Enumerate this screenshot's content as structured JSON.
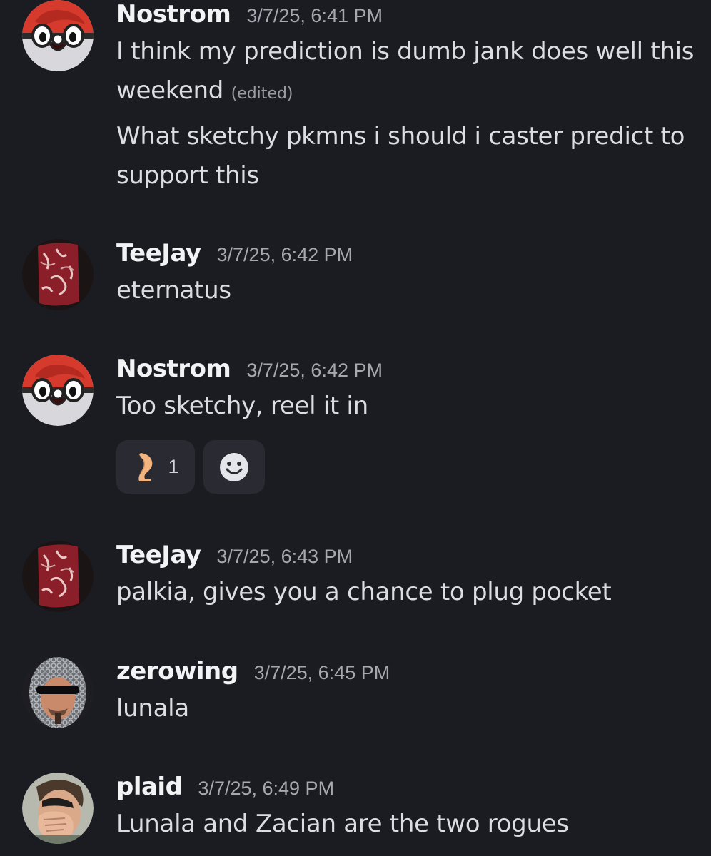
{
  "messages": [
    {
      "author": "Nostrom",
      "timestamp": "3/7/25, 6:41 PM",
      "avatar": "pokeball-mascot-avatar",
      "lines": [
        "I think my prediction is dumb jank does well this",
        "weekend",
        "What sketchy pkmns i should i caster predict to",
        "support this"
      ],
      "edited_label": "(edited)"
    },
    {
      "author": "TeeJay",
      "timestamp": "3/7/25, 6:42 PM",
      "avatar": "steak-avatar",
      "text": "eternatus"
    },
    {
      "author": "Nostrom",
      "timestamp": "3/7/25, 6:42 PM",
      "avatar": "pokeball-mascot-avatar",
      "text": "Too sketchy, reel it in",
      "reactions": [
        {
          "emoji": "leg-emoji",
          "count": "1"
        }
      ],
      "add_reaction_icon": "smiley-icon"
    },
    {
      "author": "TeeJay",
      "timestamp": "3/7/25, 6:43 PM",
      "avatar": "steak-avatar",
      "text": "palkia, gives you a chance to plug pocket"
    },
    {
      "author": "zerowing",
      "timestamp": "3/7/25, 6:45 PM",
      "avatar": "chainmail-man-avatar",
      "text": "lunala"
    },
    {
      "author": "plaid",
      "timestamp": "3/7/25, 6:49 PM",
      "avatar": "facepalm-photo-avatar",
      "text": "Lunala and Zacian are the two rogues"
    }
  ],
  "colors": {
    "background": "#1b1c22",
    "author": "#f2f3f5",
    "timestamp": "#a6a8b0",
    "text": "#dcdde2",
    "reaction_bg": "#2a2b32"
  }
}
